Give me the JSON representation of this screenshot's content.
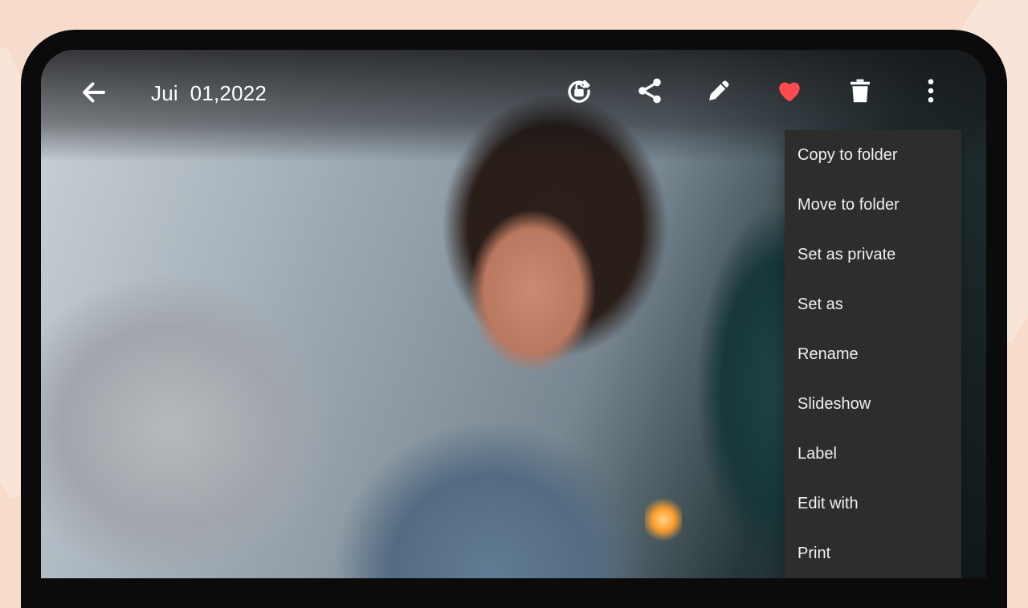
{
  "viewer": {
    "date": "Jui  01,2022",
    "liked_color": "#ff4a4f"
  },
  "toolbar": {
    "back_icon": "back-arrow-icon",
    "rotate_icon": "rotate-lock-icon",
    "share_icon": "share-icon",
    "edit_icon": "pencil-icon",
    "favorite_icon": "heart-icon",
    "delete_icon": "trash-icon",
    "more_icon": "more-vertical-icon"
  },
  "menu": {
    "items": [
      "Copy to folder",
      "Move to folder",
      "Set as private",
      "Set as",
      "Rename",
      "Slideshow",
      "Label",
      "Edit with",
      "Print"
    ]
  }
}
